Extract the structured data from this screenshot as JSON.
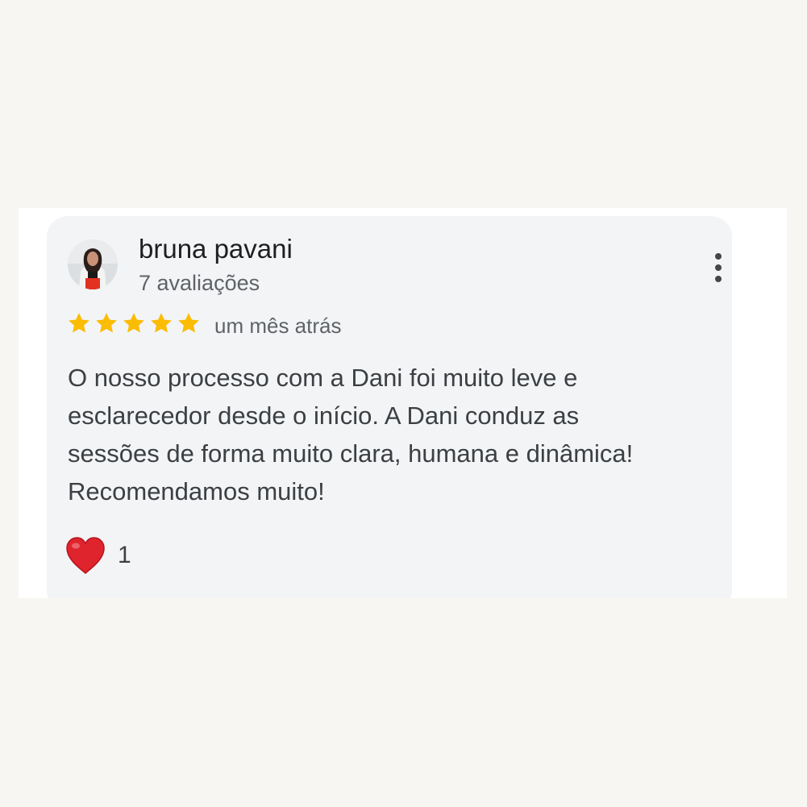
{
  "review": {
    "author_name": "bruna pavani",
    "author_reviews": "7 avaliações",
    "rating": 5,
    "rating_max": 5,
    "date": "um mês atrás",
    "text_lines": [
      "O nosso processo com a Dani foi muito leve e",
      "esclarecedor desde o início. A Dani conduz as",
      "sessões de forma muito clara, humana e dinâmica!",
      "Recomendamos muito!"
    ],
    "reaction": {
      "icon": "heart-icon",
      "count": "1"
    }
  },
  "icons": {
    "menu": "more-vert-icon",
    "star": "star-icon"
  },
  "colors": {
    "page_background": "#f8f6f2",
    "card_background": "#f3f4f6",
    "star": "#fbbc04",
    "heart": "#e0242e"
  }
}
